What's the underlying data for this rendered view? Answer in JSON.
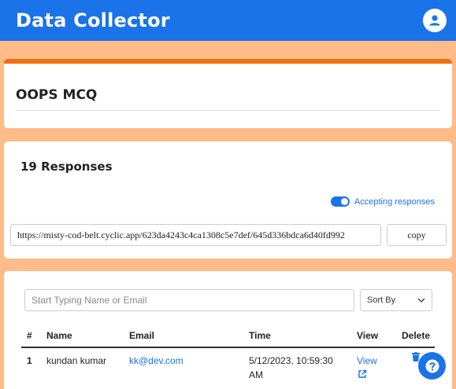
{
  "header": {
    "app_title": "Data Collector",
    "user_icon": "user-avatar-icon"
  },
  "form": {
    "title": "OOPS MCQ"
  },
  "responses": {
    "count_label": "19 Responses",
    "accepting_label": "Accepting responses",
    "accepting": true,
    "share_link": "https://misty-cod-belt.cyclic.app/623da4243c4ca1308c5e7def/645d336bdca6d40fd992",
    "copy_label": "copy"
  },
  "table": {
    "search_placeholder": "Start Typing Name or Email",
    "sort_label": "Sort By",
    "headers": {
      "num": "#",
      "name": "Name",
      "email": "Email",
      "time": "Time",
      "view": "View",
      "delete": "Delete"
    },
    "rows": [
      {
        "num": "1",
        "name": "kundan kumar",
        "email": "kk@dev.com",
        "time_line1": "5/12/2023, 10:59:30",
        "time_line2": "AM",
        "view": "View"
      }
    ]
  },
  "colors": {
    "primary": "#1a73e8",
    "accent": "#f07010",
    "background": "#ffbb88"
  }
}
